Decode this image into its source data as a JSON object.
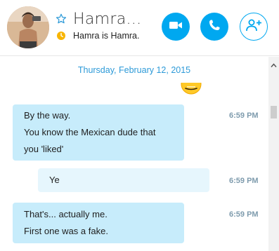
{
  "header": {
    "contact_name": "Hamra...",
    "mood_message": "Hamra is Hamra.",
    "video_icon": "video-camera-icon",
    "call_icon": "phone-icon",
    "add_icon": "add-person-icon",
    "accent_color": "#00a8f0"
  },
  "conversation": {
    "date_separator": "Thursday, February 12, 2015",
    "messages": [
      {
        "lines": [
          "By the way.",
          "You know the Mexican dude that",
          "you 'liked'"
        ],
        "time": "6:59 PM"
      },
      {
        "lines": [
          "Ye"
        ],
        "time": "6:59 PM"
      },
      {
        "lines": [
          "That's... actually me.",
          "First one was a fake."
        ],
        "time": "6:59 PM"
      }
    ]
  }
}
